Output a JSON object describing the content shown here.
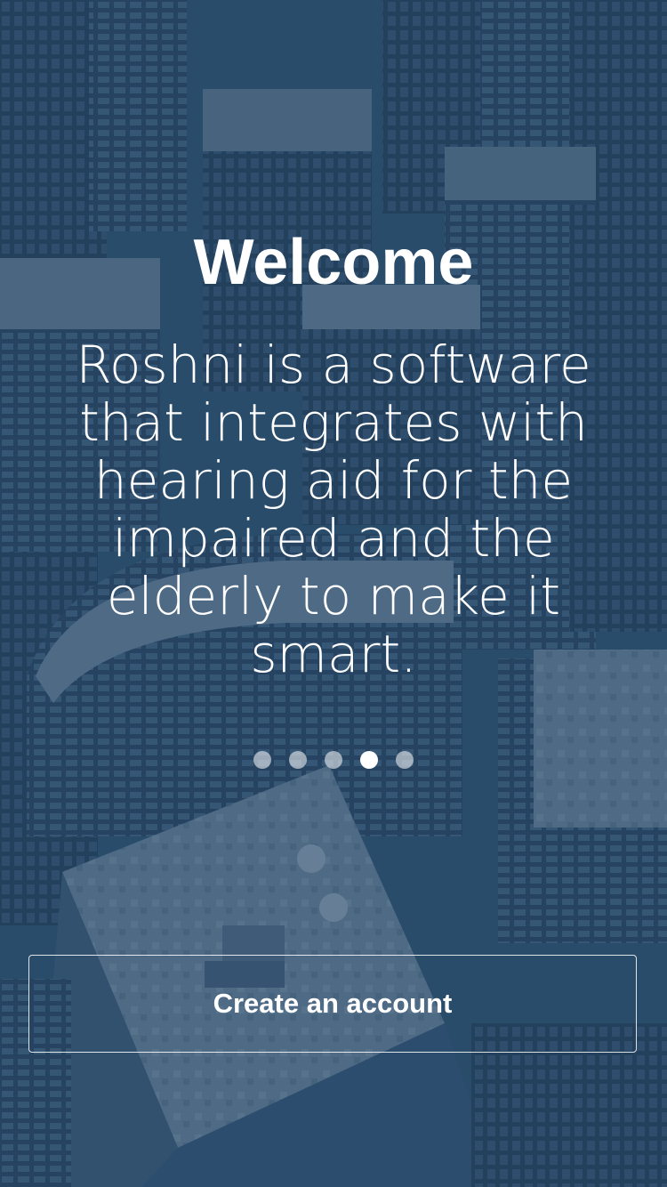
{
  "welcome": {
    "title": "Welcome",
    "description": "Roshni is a software that integrates with hearing aid for the im­paired and the elderly to make it smart."
  },
  "pager": {
    "count": 5,
    "active_index": 3
  },
  "cta": {
    "label": "Create an account"
  },
  "colors": {
    "overlay": "#264664",
    "text": "#ffffff",
    "dot_inactive": "#a9b6c3",
    "dot_active": "#ffffff"
  }
}
